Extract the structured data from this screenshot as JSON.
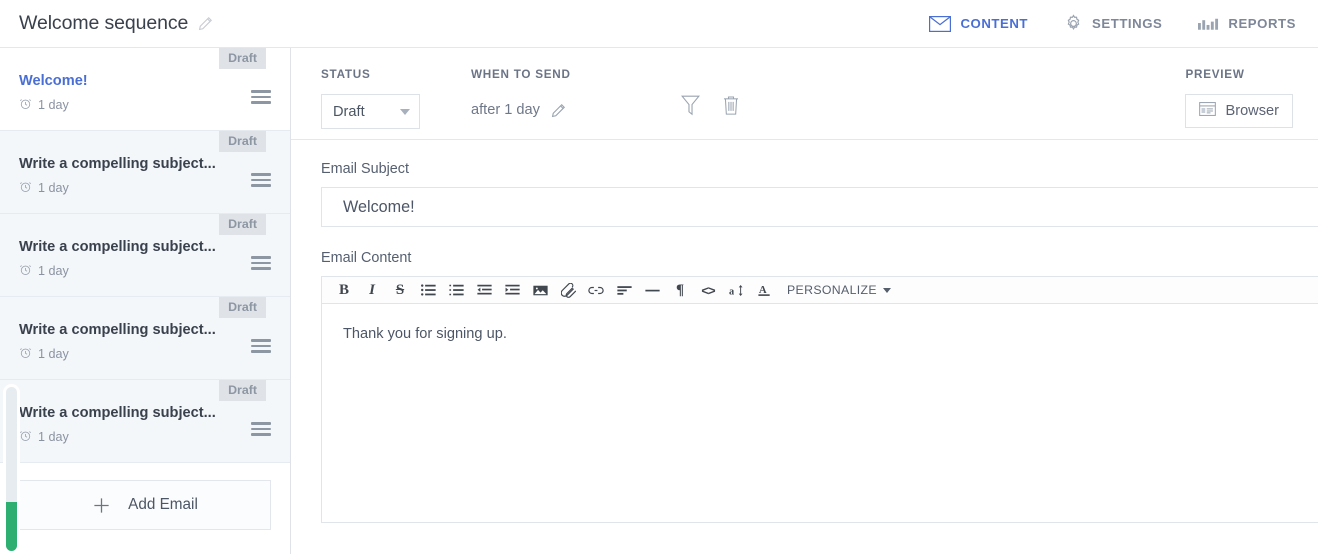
{
  "header": {
    "title": "Welcome sequence",
    "edit_icon": "pencil-icon",
    "nav": [
      {
        "label": "CONTENT",
        "icon": "envelope-icon",
        "active": true
      },
      {
        "label": "SETTINGS",
        "icon": "gear-icon",
        "active": false
      },
      {
        "label": "REPORTS",
        "icon": "bar-chart-icon",
        "active": false
      }
    ]
  },
  "sidebar": {
    "emails": [
      {
        "badge": "Draft",
        "title": "Welcome!",
        "delay": "1 day",
        "active": true
      },
      {
        "badge": "Draft",
        "title": "Write a compelling subject...",
        "delay": "1 day",
        "active": false
      },
      {
        "badge": "Draft",
        "title": "Write a compelling subject...",
        "delay": "1 day",
        "active": false
      },
      {
        "badge": "Draft",
        "title": "Write a compelling subject...",
        "delay": "1 day",
        "active": false
      },
      {
        "badge": "Draft",
        "title": "Write a compelling subject...",
        "delay": "1 day",
        "active": false
      }
    ],
    "add_email_label": "Add Email",
    "slider": {
      "fill_percent": 30,
      "fill_color": "#2eaf72",
      "track_color": "#e7ecf1"
    }
  },
  "action_bar": {
    "status_label": "STATUS",
    "status_value": "Draft",
    "status_options": [
      "Draft"
    ],
    "when_label": "WHEN TO SEND",
    "when_value": "after 1 day",
    "when_edit_icon": "pencil-icon",
    "filter_icon": "funnel-icon",
    "delete_icon": "trash-icon",
    "preview_label": "PREVIEW",
    "preview_button": "Browser",
    "preview_icon": "browser-window-icon"
  },
  "form": {
    "subject_label": "Email Subject",
    "subject_value": "Welcome!",
    "content_label": "Email Content",
    "content_value": "Thank you for signing up."
  },
  "editor_toolbar": {
    "buttons": [
      {
        "name": "bold-icon",
        "glyph": "B"
      },
      {
        "name": "italic-icon",
        "glyph": "I"
      },
      {
        "name": "strikethrough-icon",
        "glyph": "S"
      },
      {
        "name": "unordered-list-icon",
        "glyph": ""
      },
      {
        "name": "ordered-list-icon",
        "glyph": ""
      },
      {
        "name": "outdent-icon",
        "glyph": ""
      },
      {
        "name": "indent-icon",
        "glyph": ""
      },
      {
        "name": "image-icon",
        "glyph": ""
      },
      {
        "name": "attachment-icon",
        "glyph": ""
      },
      {
        "name": "link-icon",
        "glyph": ""
      },
      {
        "name": "align-left-icon",
        "glyph": ""
      },
      {
        "name": "horizontal-rule-icon",
        "glyph": ""
      },
      {
        "name": "paragraph-icon",
        "glyph": "¶"
      },
      {
        "name": "code-icon",
        "glyph": "<>"
      },
      {
        "name": "font-size-icon",
        "glyph": ""
      },
      {
        "name": "text-color-icon",
        "glyph": "A"
      }
    ],
    "personalize_label": "PERSONALIZE"
  },
  "colors": {
    "accent_blue": "#4a6fd4",
    "muted_text": "#8a93a2",
    "panel_bg": "#f4f7fa",
    "border": "#e4e8ee",
    "green": "#2eaf72"
  }
}
